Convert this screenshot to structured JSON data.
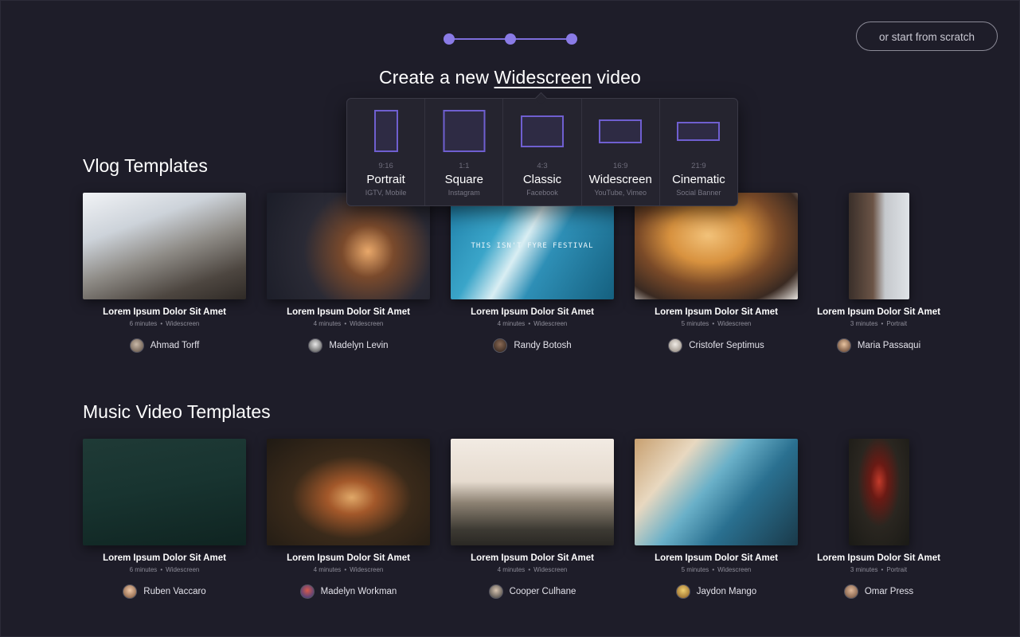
{
  "header": {
    "steps": 3,
    "current_step": 1,
    "scratch_button": "or start from scratch",
    "title_prefix": "Create a new ",
    "title_format": "Widescreen",
    "title_suffix": " video"
  },
  "formats": [
    {
      "ratio": "9:16",
      "name": "Portrait",
      "sub": "IGTV, Mobile"
    },
    {
      "ratio": "1:1",
      "name": "Square",
      "sub": "Instagram"
    },
    {
      "ratio": "4:3",
      "name": "Classic",
      "sub": "Facebook"
    },
    {
      "ratio": "16:9",
      "name": "Widescreen",
      "sub": "YouTube, Vimeo"
    },
    {
      "ratio": "21:9",
      "name": "Cinematic",
      "sub": "Social Banner"
    }
  ],
  "sections": [
    {
      "title": "Vlog Templates",
      "cards": [
        {
          "title": "Lorem Ipsum Dolor Sit Amet",
          "duration": "6 minutes",
          "format": "Widescreen",
          "author": "Ahmad Torff"
        },
        {
          "title": "Lorem Ipsum Dolor Sit Amet",
          "duration": "4 minutes",
          "format": "Widescreen",
          "author": "Madelyn Levin"
        },
        {
          "title": "Lorem Ipsum Dolor Sit Amet",
          "duration": "4 minutes",
          "format": "Widescreen",
          "author": "Randy Botosh",
          "overlay": "THIS ISN'T FYRE FESTIVAL"
        },
        {
          "title": "Lorem Ipsum Dolor Sit Amet",
          "duration": "5 minutes",
          "format": "Widescreen",
          "author": "Cristofer Septimus"
        },
        {
          "title": "Lorem Ipsum Dolor Sit Amet",
          "duration": "3 minutes",
          "format": "Portrait",
          "author": "Maria Passaqui"
        }
      ]
    },
    {
      "title": "Music Video Templates",
      "cards": [
        {
          "title": "Lorem Ipsum Dolor Sit Amet",
          "duration": "6 minutes",
          "format": "Widescreen",
          "author": "Ruben Vaccaro"
        },
        {
          "title": "Lorem Ipsum Dolor Sit Amet",
          "duration": "4 minutes",
          "format": "Widescreen",
          "author": "Madelyn Workman"
        },
        {
          "title": "Lorem Ipsum Dolor Sit Amet",
          "duration": "4 minutes",
          "format": "Widescreen",
          "author": "Cooper Culhane"
        },
        {
          "title": "Lorem Ipsum Dolor Sit Amet",
          "duration": "5 minutes",
          "format": "Widescreen",
          "author": "Jaydon Mango"
        },
        {
          "title": "Lorem Ipsum Dolor Sit Amet",
          "duration": "3 minutes",
          "format": "Portrait",
          "author": "Omar Press"
        }
      ]
    }
  ],
  "colors": {
    "background": "#1e1d29",
    "accent": "#8a7be6",
    "popup": "#25242f"
  }
}
